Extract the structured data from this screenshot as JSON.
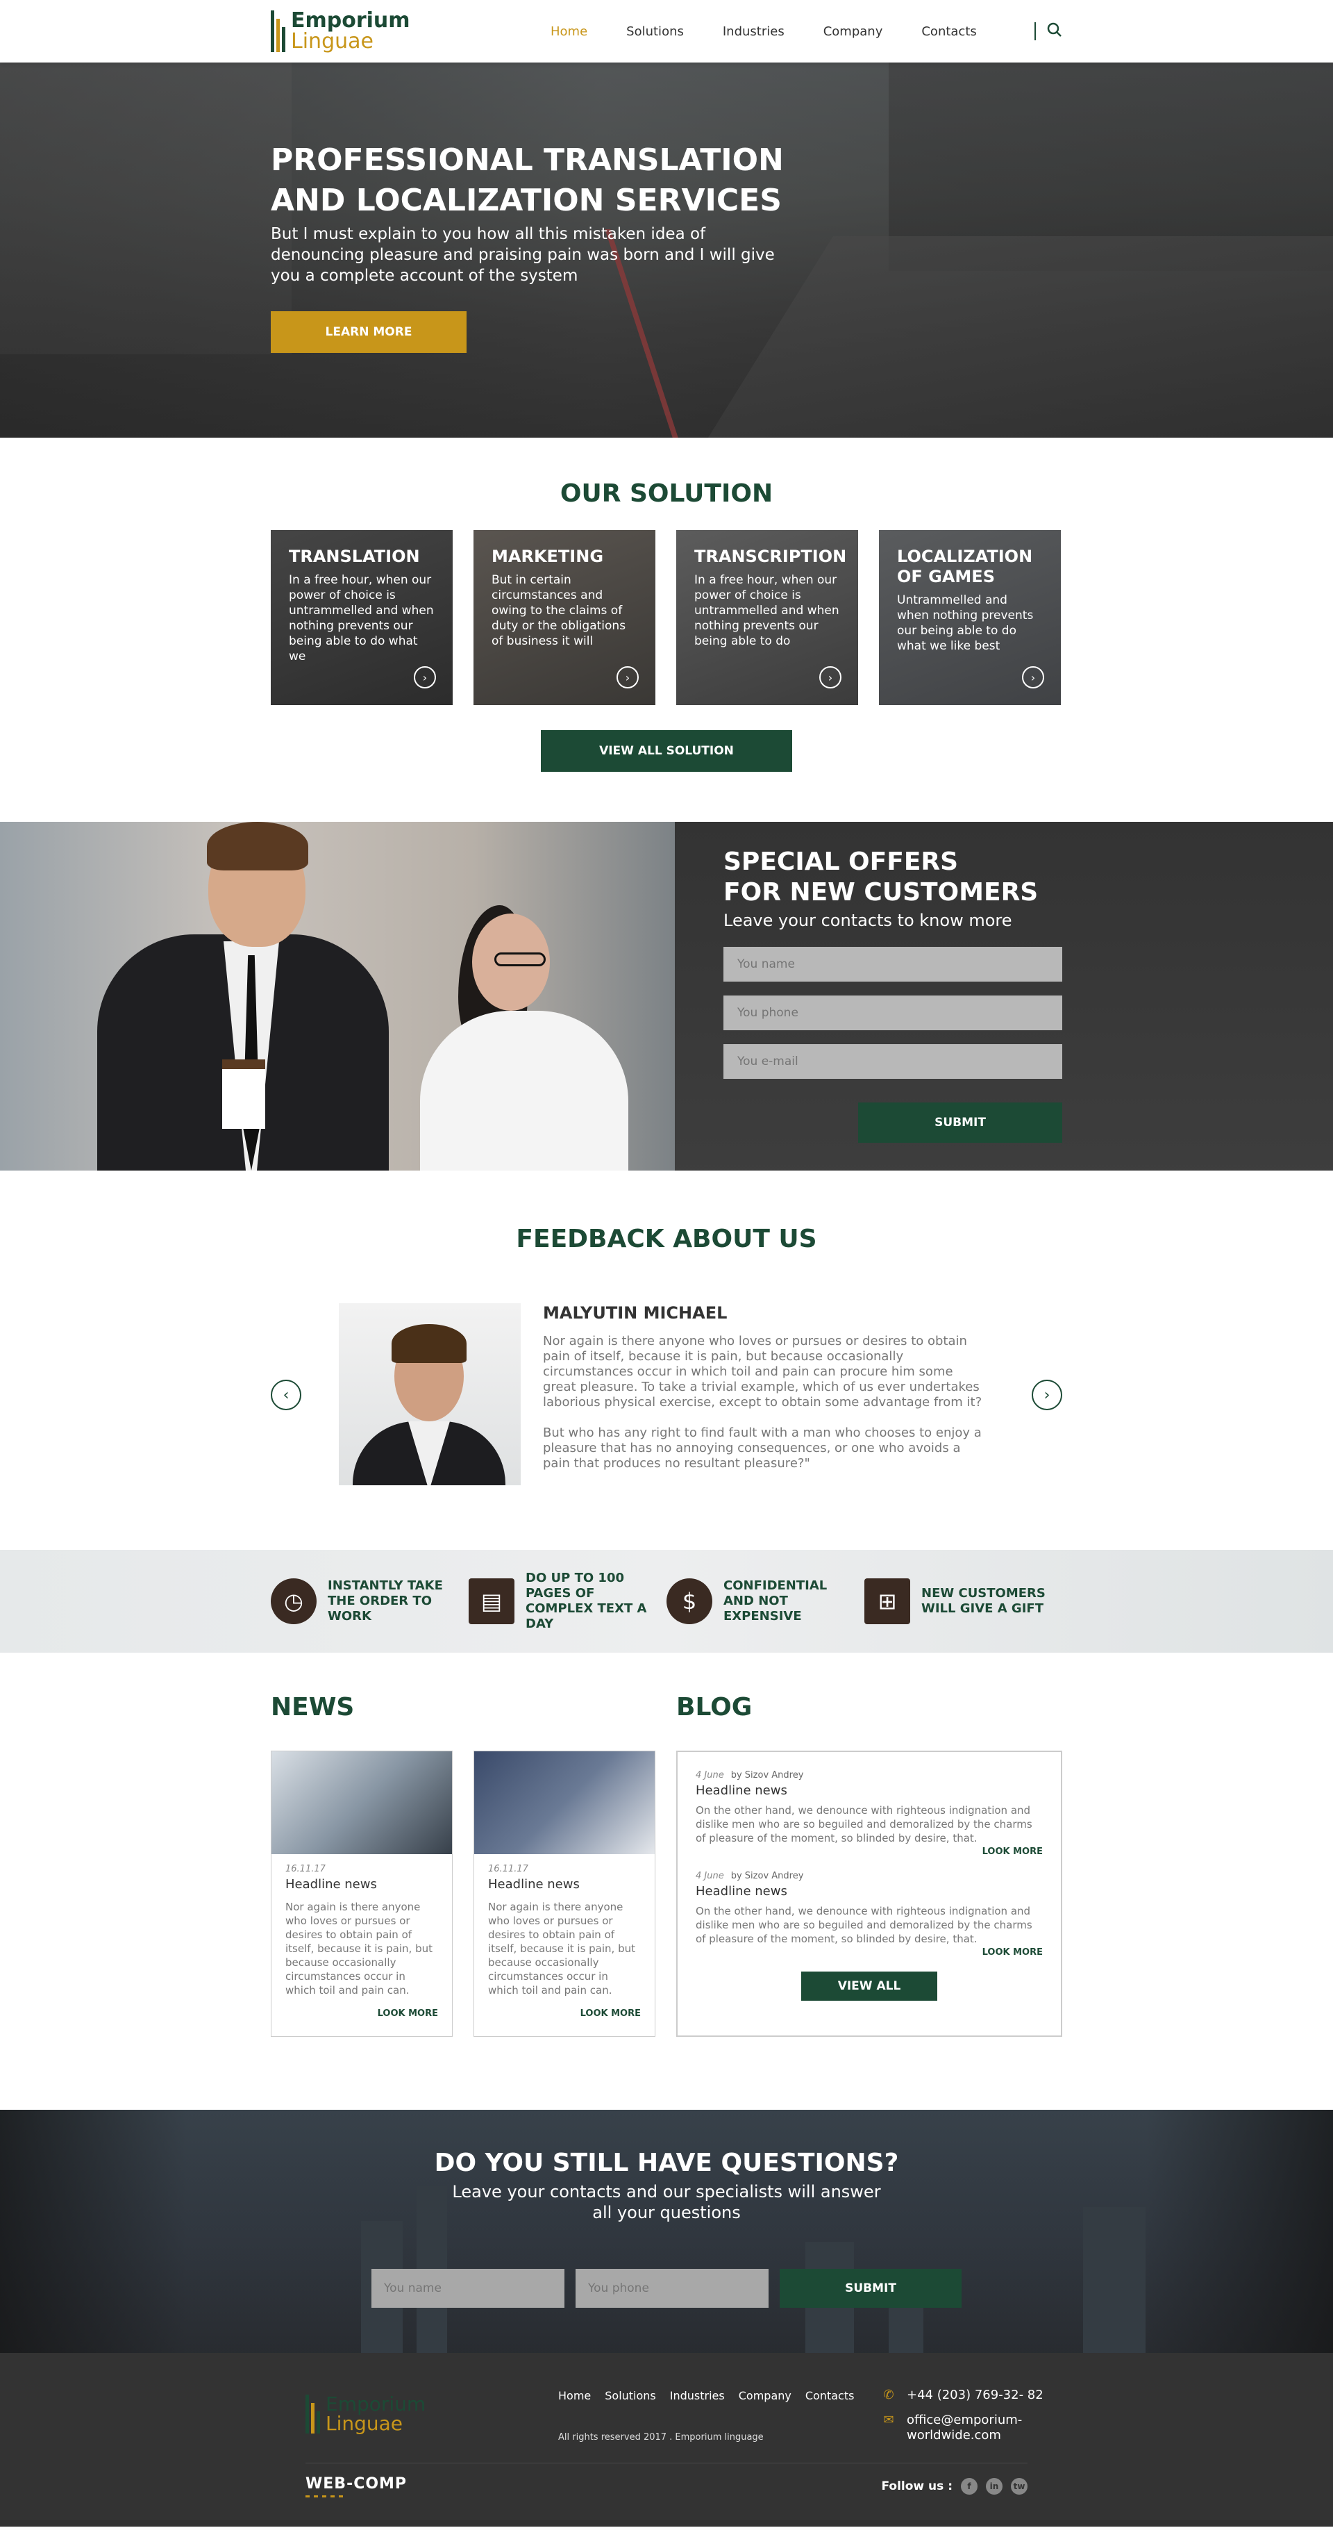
{
  "header": {
    "logo_line1": "Emporium",
    "logo_line2": "Linguae",
    "nav": [
      "Home",
      "Solutions",
      "Industries",
      "Company",
      "Contacts"
    ],
    "active_nav": "Home"
  },
  "hero": {
    "title": "PROFESSIONAL TRANSLATION AND LOCALIZATION SERVICES",
    "text": "But I must explain to you how all this mistaken idea of denouncing pleasure and praising pain was born and I will give you a complete account of the system",
    "button": "LEARN MORE"
  },
  "solution": {
    "title": "OUR SOLUTION",
    "cards": [
      {
        "title": "TRANSLATION",
        "text": "In a free hour, when our power of choice is untrammelled and when nothing prevents our being able to do what we"
      },
      {
        "title": "MARKETING",
        "text": "But in certain circumstances and owing to the claims of duty or the obligations of business it will"
      },
      {
        "title": "TRANSCRIPTION",
        "text": "In a free hour, when our power of choice is untrammelled and when nothing prevents our being able to do"
      },
      {
        "title": "LOCALIZATION OF GAMES",
        "text": "Untrammelled and when nothing prevents our being able to do what we like best"
      }
    ],
    "button": "VIEW ALL SOLUTION"
  },
  "offers": {
    "title_line1": "SPECIAL OFFERS",
    "title_line2": "FOR NEW CUSTOMERS",
    "subtitle": "Leave your contacts to know more",
    "name_placeholder": "You name",
    "phone_placeholder": "You phone",
    "email_placeholder": "You e-mail",
    "button": "SUBMIT"
  },
  "feedback": {
    "title": "FEEDBACK ABOUT US",
    "name": "MALYUTIN MICHAEL",
    "para1": "Nor again is there anyone who loves or pursues or desires to obtain pain of itself, because it is pain, but because occasionally circumstances occur in which toil and pain can procure him some great pleasure. To take a trivial example, which of us ever undertakes laborious physical exercise, except to obtain some advantage from it?",
    "para2": "But who has any right to find fault with a man who chooses to enjoy a pleasure that has no annoying consequences, or one who avoids a pain that produces no resultant pleasure?\""
  },
  "features": [
    {
      "icon": "clock-icon",
      "glyph": "◷",
      "text": "INSTANTLY TAKE THE ORDER TO WORK"
    },
    {
      "icon": "document-icon",
      "glyph": "▤",
      "text": "DO UP TO 100 PAGES OF COMPLEX TEXT A DAY"
    },
    {
      "icon": "dollar-icon",
      "glyph": "$",
      "text": "CONFIDENTIAL AND NOT EXPENSIVE"
    },
    {
      "icon": "gift-icon",
      "glyph": "⊞",
      "text": "NEW CUSTOMERS WILL GIVE A GIFT"
    }
  ],
  "news": {
    "title": "NEWS",
    "items": [
      {
        "date": "16.11.17",
        "headline": "Headline news",
        "text": "Nor again is there anyone who loves or pursues or desires to obtain pain of itself, because it is pain, but because occasionally circumstances occur in which toil and pain can.",
        "more": "LOOK MORE"
      },
      {
        "date": "16.11.17",
        "headline": "Headline news",
        "text": "Nor again is there anyone who loves or pursues or desires to obtain pain of itself, because it is pain, but because occasionally circumstances occur in which toil and pain can.",
        "more": "LOOK MORE"
      }
    ]
  },
  "blog": {
    "title": "BLOG",
    "posts": [
      {
        "date": "4 June",
        "author": "by Sizov Andrey",
        "headline": "Headline news",
        "text": "On the other hand, we denounce with righteous indignation and dislike men who are so beguiled and demoralized by the charms of pleasure of the moment, so blinded by desire, that.",
        "more": "LOOK MORE"
      },
      {
        "date": "4 June",
        "author": "by Sizov Andrey",
        "headline": "Headline news",
        "text": "On the other hand, we denounce with righteous indignation and dislike men who are so beguiled and demoralized by the charms of pleasure of the moment, so blinded by desire, that.",
        "more": "LOOK MORE"
      }
    ],
    "button": "VIEW ALL"
  },
  "questions": {
    "title": "DO YOU STILL HAVE QUESTIONS?",
    "text": "Leave your contacts and our specialists will answer all your questions",
    "name_placeholder": "You name",
    "phone_placeholder": "You phone",
    "button": "SUBMIT"
  },
  "footer": {
    "logo_line1": "Emporium",
    "logo_line2": "Linguae",
    "nav": [
      "Home",
      "Solutions",
      "Industries",
      "Company",
      "Contacts"
    ],
    "copyright": "All rights reserved 2017 . Emporium linguage",
    "phone": "+44 (203) 769-32- 82",
    "email": "office@emporium-worldwide.com",
    "brand": "WEB-COMP",
    "follow": "Follow us :",
    "social": [
      "f",
      "in",
      "tw"
    ]
  },
  "colors": {
    "primary_green": "#1c4a35",
    "accent_gold": "#c8961a",
    "footer_bg": "#333333"
  }
}
